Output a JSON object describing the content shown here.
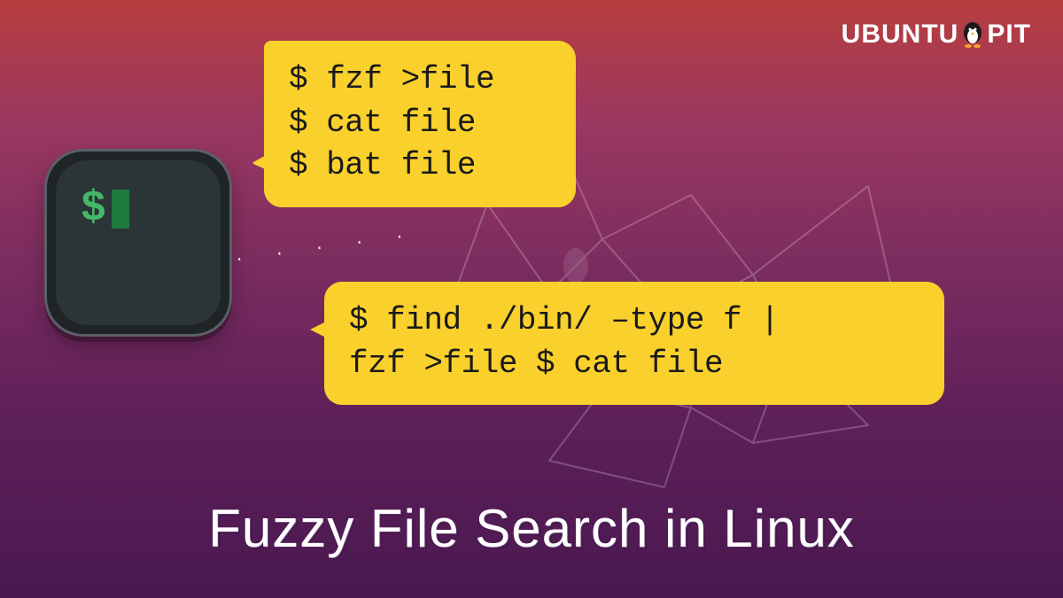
{
  "logo": {
    "part1": "UBUNTU",
    "part2": "PIT"
  },
  "terminal": {
    "prompt_symbol": "$"
  },
  "bubbles": {
    "top": {
      "line1": "$ fzf >file",
      "line2": "$ cat file",
      "line3": "$ bat file"
    },
    "bottom": {
      "line1": "$ find ./bin/ –type f |",
      "line2": "fzf >file $ cat file"
    }
  },
  "title": "Fuzzy File Search in Linux"
}
